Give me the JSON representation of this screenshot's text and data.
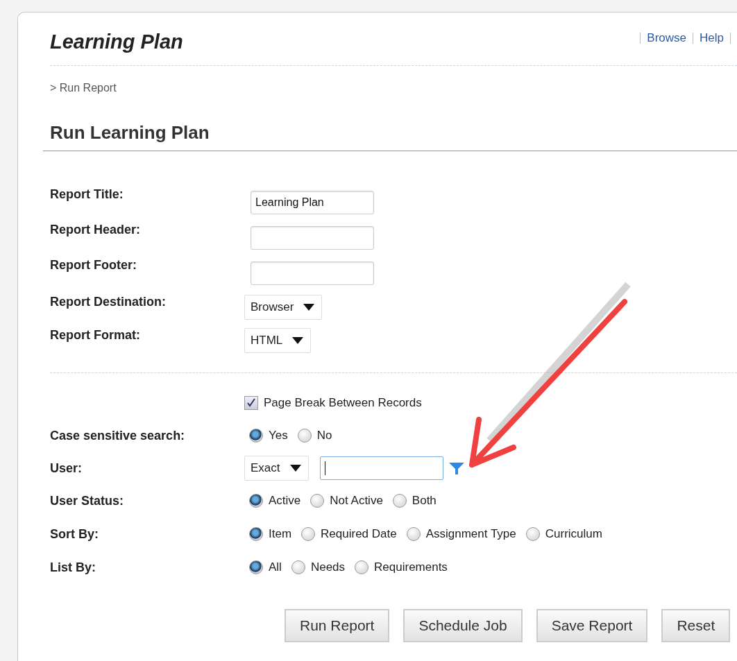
{
  "header": {
    "title": "Learning Plan",
    "links": [
      "Browse",
      "Help"
    ]
  },
  "breadcrumb": "> Run Report",
  "heading": "Run Learning Plan",
  "report_fields": [
    {
      "kind": "text",
      "label": "Report Title:",
      "value": "Learning Plan"
    },
    {
      "kind": "text",
      "label": "Report Header:"
    },
    {
      "kind": "text",
      "label": "Report Footer:"
    },
    {
      "kind": "select",
      "label": "Report Destination:",
      "value": "Browser"
    },
    {
      "kind": "select",
      "label": "Report Format:",
      "value": "HTML"
    }
  ],
  "options": [
    {
      "kind": "checkbox",
      "text": "Page Break Between Records",
      "checked": true
    },
    {
      "kind": "radio",
      "label": "Case sensitive search:",
      "choices": [
        {
          "text": "Yes",
          "selected": true
        },
        {
          "text": "No",
          "selected": false
        }
      ]
    },
    {
      "kind": "search",
      "label": "User:",
      "value": "Exact",
      "focused": true
    },
    {
      "kind": "radio",
      "label": "User Status:",
      "choices": [
        {
          "text": "Active",
          "selected": true
        },
        {
          "text": "Not Active",
          "selected": false
        },
        {
          "text": "Both",
          "selected": false
        }
      ]
    },
    {
      "kind": "radio",
      "label": "Sort By:",
      "choices": [
        {
          "text": "Item",
          "selected": true
        },
        {
          "text": "Required Date",
          "selected": false
        },
        {
          "text": "Assignment Type",
          "selected": false
        },
        {
          "text": "Curriculum",
          "selected": false
        }
      ]
    },
    {
      "kind": "radio",
      "label": "List By:",
      "choices": [
        {
          "text": "All",
          "selected": true
        },
        {
          "text": "Needs",
          "selected": false
        },
        {
          "text": "Requirements",
          "selected": false
        }
      ]
    }
  ],
  "buttons": [
    "Run Report",
    "Schedule Job",
    "Save Report",
    "Reset"
  ],
  "annotation": {
    "kind": "arrow"
  }
}
